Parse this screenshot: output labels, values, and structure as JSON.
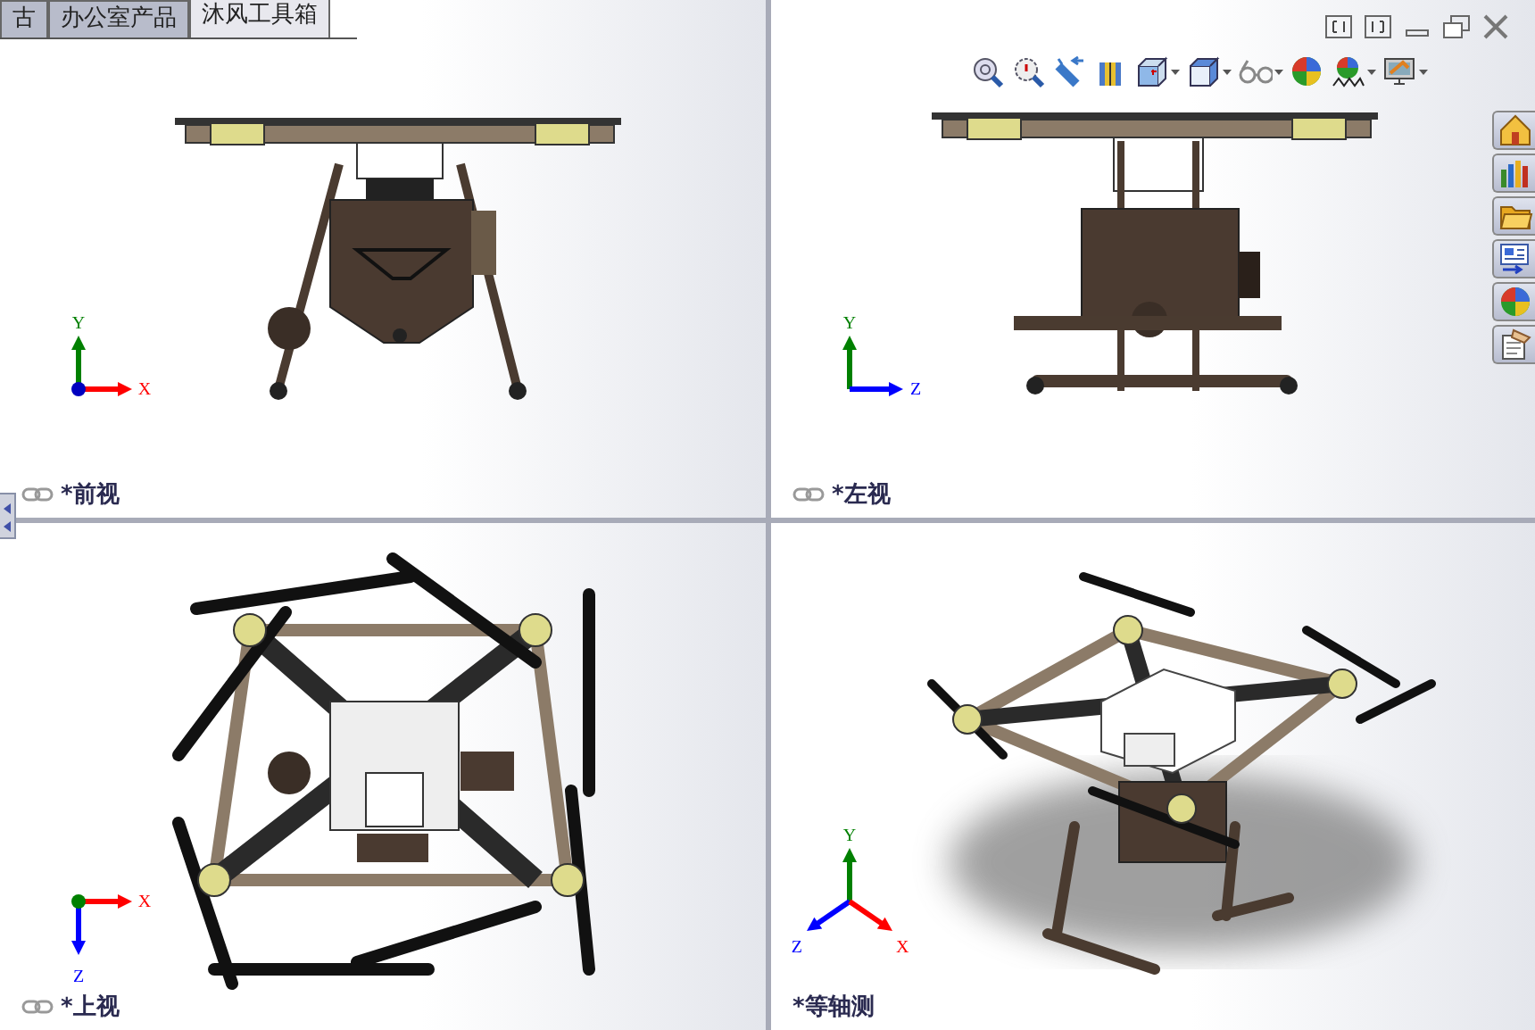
{
  "tabs": [
    {
      "label": "古",
      "selected": false
    },
    {
      "label": "办公室产品",
      "selected": false
    },
    {
      "label": "沐风工具箱",
      "selected": true
    }
  ],
  "window_controls": [
    {
      "kind": "tile-left"
    },
    {
      "kind": "tile-right"
    },
    {
      "kind": "minimize"
    },
    {
      "kind": "restore"
    },
    {
      "kind": "close"
    }
  ],
  "view_toolbar": [
    {
      "kind": "zoom-fit",
      "dropdown": false
    },
    {
      "kind": "zoom-area",
      "dropdown": false
    },
    {
      "kind": "previous-view",
      "dropdown": false
    },
    {
      "kind": "section",
      "dropdown": false
    },
    {
      "kind": "orientation",
      "dropdown": true
    },
    {
      "kind": "display-style",
      "dropdown": true
    },
    {
      "kind": "hide-show",
      "dropdown": true
    },
    {
      "kind": "appearance",
      "dropdown": false
    },
    {
      "kind": "scene",
      "dropdown": true
    },
    {
      "kind": "view-settings",
      "dropdown": true
    }
  ],
  "task_pane": [
    {
      "kind": "home"
    },
    {
      "kind": "library"
    },
    {
      "kind": "folder"
    },
    {
      "kind": "palette"
    },
    {
      "kind": "appearance"
    },
    {
      "kind": "properties"
    }
  ],
  "viewports": [
    {
      "label": "*前视",
      "kind": "front",
      "linked": true,
      "axes": [
        {
          "label": "Y",
          "color": "#008000"
        },
        {
          "label": "X",
          "color": "#ff0000"
        }
      ]
    },
    {
      "label": "*左视",
      "kind": "left",
      "linked": true,
      "axes": [
        {
          "label": "Y",
          "color": "#008000"
        },
        {
          "label": "Z",
          "color": "#0000ff"
        }
      ]
    },
    {
      "label": "*上视",
      "kind": "top",
      "linked": true,
      "axes": [
        {
          "label": "X",
          "color": "#ff0000"
        },
        {
          "label": "Z",
          "color": "#0000ff"
        }
      ]
    },
    {
      "label": "*等轴测",
      "kind": "iso",
      "linked": false,
      "axes": [
        {
          "label": "Y",
          "color": "#008000"
        },
        {
          "label": "Z",
          "color": "#0000ff"
        },
        {
          "label": "X",
          "color": "#ff0000"
        }
      ]
    }
  ]
}
